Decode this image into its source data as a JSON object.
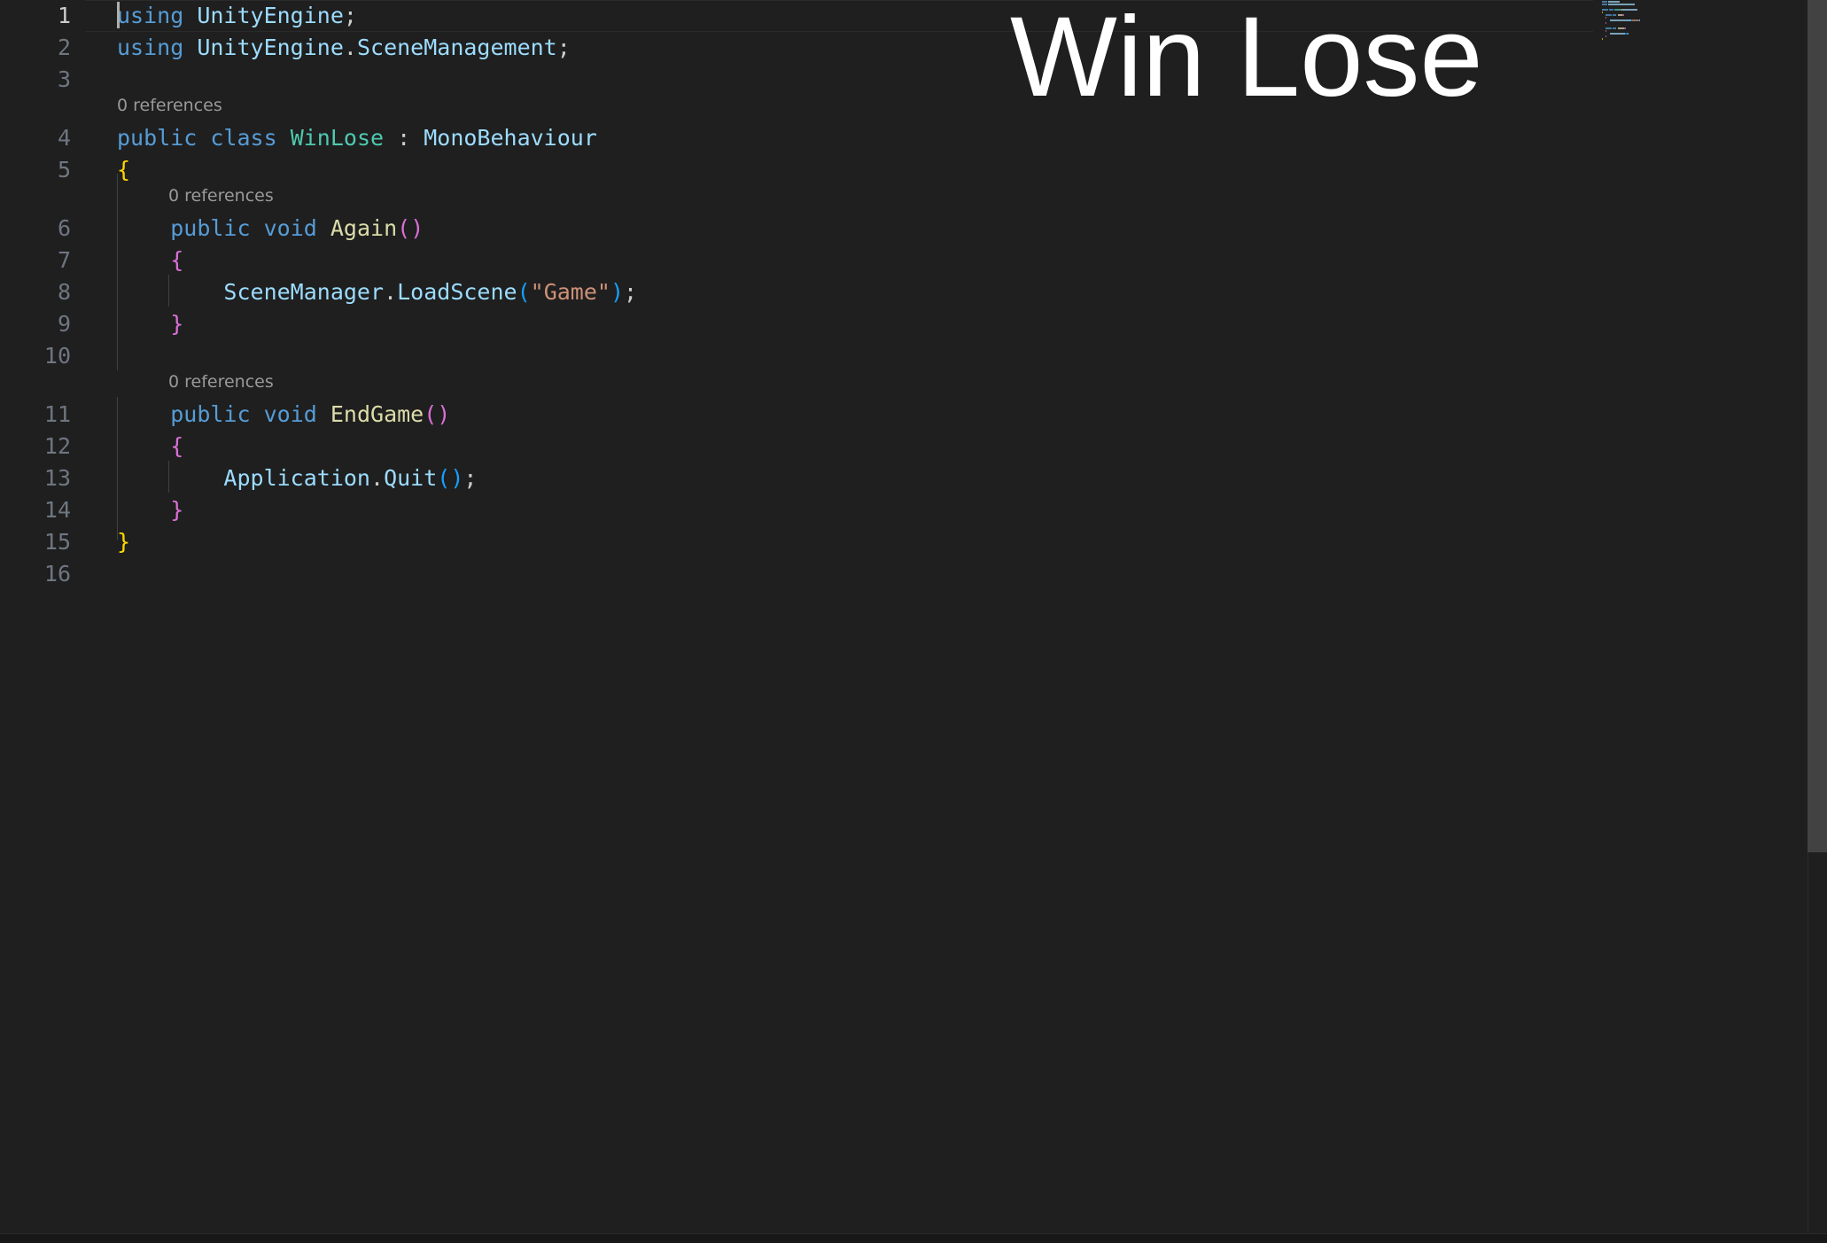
{
  "overlay": {
    "title": "Win Lose"
  },
  "editor": {
    "codelens": "0 references",
    "lines": [
      {
        "num": "1",
        "tokens": [
          {
            "t": "using",
            "c": "#569cd6"
          },
          {
            "t": " "
          },
          {
            "t": "UnityEngine",
            "c": "#9cdcfe"
          },
          {
            "t": ";",
            "c": "#cccccc"
          }
        ]
      },
      {
        "num": "2",
        "tokens": [
          {
            "t": "using",
            "c": "#569cd6"
          },
          {
            "t": " "
          },
          {
            "t": "UnityEngine",
            "c": "#9cdcfe"
          },
          {
            "t": ".",
            "c": "#cccccc"
          },
          {
            "t": "SceneManagement",
            "c": "#9cdcfe"
          },
          {
            "t": ";",
            "c": "#cccccc"
          }
        ]
      },
      {
        "num": "3",
        "tokens": []
      },
      {
        "num": "4",
        "tokens": [
          {
            "t": "public",
            "c": "#569cd6"
          },
          {
            "t": " "
          },
          {
            "t": "class",
            "c": "#569cd6"
          },
          {
            "t": " "
          },
          {
            "t": "WinLose",
            "c": "#4ec9b0"
          },
          {
            "t": " : ",
            "c": "#cccccc"
          },
          {
            "t": "MonoBehaviour",
            "c": "#9cdcfe"
          }
        ]
      },
      {
        "num": "5",
        "tokens": [
          {
            "t": "{",
            "c": "#ffd700"
          }
        ]
      },
      {
        "num": "6",
        "tokens": [
          {
            "t": "    "
          },
          {
            "t": "public",
            "c": "#569cd6"
          },
          {
            "t": " "
          },
          {
            "t": "void",
            "c": "#569cd6"
          },
          {
            "t": " "
          },
          {
            "t": "Again",
            "c": "#dcdcaa"
          },
          {
            "t": "()",
            "c": "#da70d6"
          }
        ]
      },
      {
        "num": "7",
        "tokens": [
          {
            "t": "    "
          },
          {
            "t": "{",
            "c": "#da70d6"
          }
        ]
      },
      {
        "num": "8",
        "tokens": [
          {
            "t": "        "
          },
          {
            "t": "SceneManager",
            "c": "#9cdcfe"
          },
          {
            "t": ".",
            "c": "#cccccc"
          },
          {
            "t": "LoadScene",
            "c": "#9cdcfe"
          },
          {
            "t": "(",
            "c": "#179fff"
          },
          {
            "t": "\"Game\"",
            "c": "#ce9178"
          },
          {
            "t": ")",
            "c": "#179fff"
          },
          {
            "t": ";",
            "c": "#cccccc"
          }
        ]
      },
      {
        "num": "9",
        "tokens": [
          {
            "t": "    "
          },
          {
            "t": "}",
            "c": "#da70d6"
          }
        ]
      },
      {
        "num": "10",
        "tokens": []
      },
      {
        "num": "11",
        "tokens": [
          {
            "t": "    "
          },
          {
            "t": "public",
            "c": "#569cd6"
          },
          {
            "t": " "
          },
          {
            "t": "void",
            "c": "#569cd6"
          },
          {
            "t": " "
          },
          {
            "t": "EndGame",
            "c": "#dcdcaa"
          },
          {
            "t": "()",
            "c": "#da70d6"
          }
        ]
      },
      {
        "num": "12",
        "tokens": [
          {
            "t": "    "
          },
          {
            "t": "{",
            "c": "#da70d6"
          }
        ]
      },
      {
        "num": "13",
        "tokens": [
          {
            "t": "        "
          },
          {
            "t": "Application",
            "c": "#9cdcfe"
          },
          {
            "t": ".",
            "c": "#cccccc"
          },
          {
            "t": "Quit",
            "c": "#9cdcfe"
          },
          {
            "t": "()",
            "c": "#179fff"
          },
          {
            "t": ";",
            "c": "#cccccc"
          }
        ]
      },
      {
        "num": "14",
        "tokens": [
          {
            "t": "    "
          },
          {
            "t": "}",
            "c": "#da70d6"
          }
        ]
      },
      {
        "num": "15",
        "tokens": [
          {
            "t": "}",
            "c": "#ffd700"
          }
        ]
      },
      {
        "num": "16",
        "tokens": []
      }
    ]
  }
}
